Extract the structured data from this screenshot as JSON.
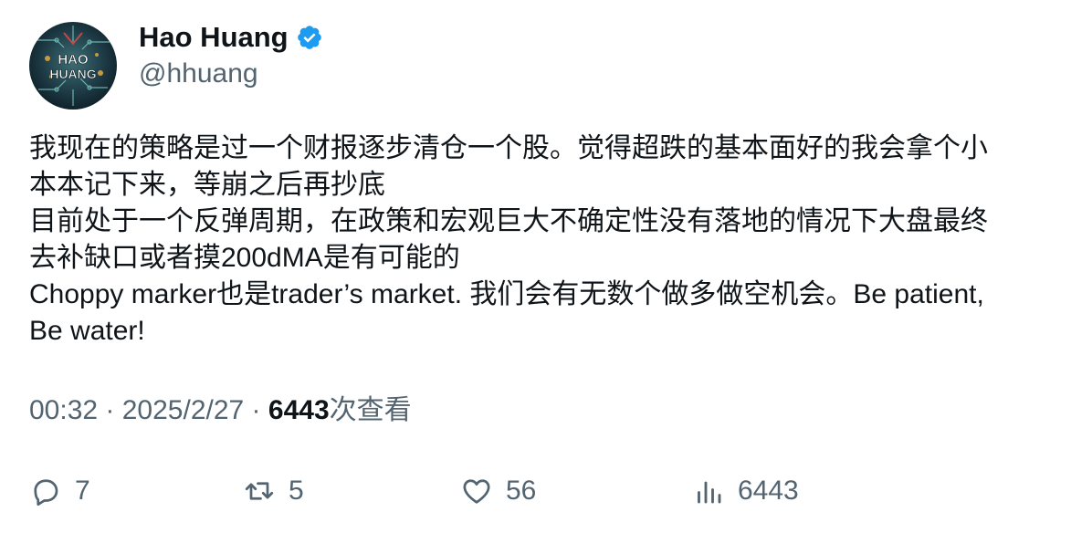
{
  "author": {
    "display_name": "Hao Huang",
    "handle": "@hhuang",
    "avatar_text_line1": "HAO",
    "avatar_text_line2": "HUANG",
    "verified": true
  },
  "tweet": {
    "lines": [
      "我现在的策略是过一个财报逐步清仓一个股。觉得超跌的基本面好的我会拿个小",
      "本本记下来，等崩之后再抄底",
      "目前处于一个反弹周期，在政策和宏观巨大不确定性没有落地的情况下大盘最终",
      "去补缺口或者摸200dMA是有可能的",
      "Choppy marker也是trader’s market. 我们会有无数个做多做空机会。Be patient,",
      "Be water!"
    ]
  },
  "meta": {
    "time": "00:32",
    "separator": " · ",
    "date": "2025/2/27",
    "views_count": "6443",
    "views_suffix": "次查看"
  },
  "actions": {
    "reply_count": "7",
    "retweet_count": "5",
    "like_count": "56",
    "views_count": "6443"
  },
  "colors": {
    "text": "#0f1419",
    "secondary": "#536471",
    "verified": "#1d9bf0"
  }
}
